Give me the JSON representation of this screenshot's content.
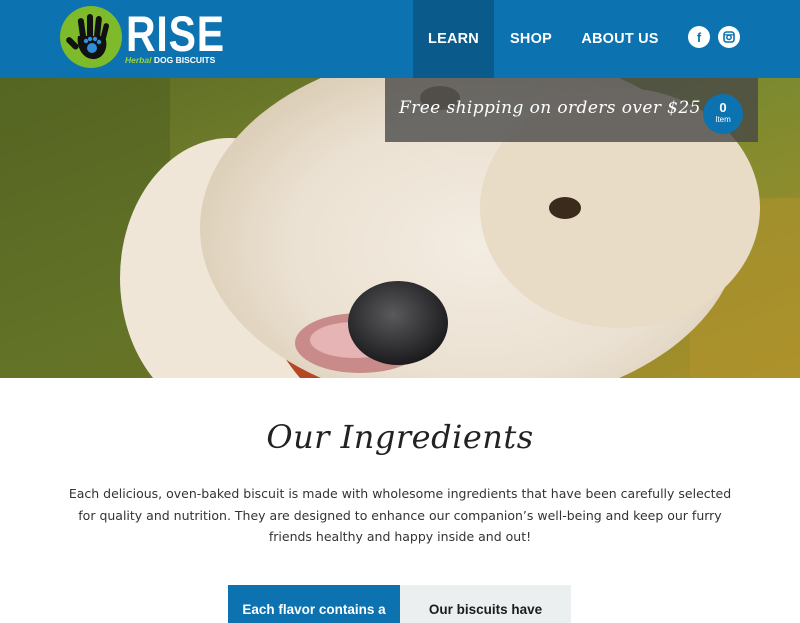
{
  "header": {
    "logo": {
      "wordmark": "RISE",
      "tagline_herbal": "Herbal",
      "tagline_rest": "DOG BISCUITS"
    },
    "nav": [
      {
        "label": "LEARN",
        "active": true
      },
      {
        "label": "SHOP",
        "active": false
      },
      {
        "label": "ABOUT US",
        "active": false
      }
    ],
    "social": {
      "facebook_glyph": "f",
      "instagram_icon": "instagram-icon"
    },
    "colors": {
      "header_bg": "#0d72b0",
      "active_nav_bg": "#0a5a8c",
      "logo_green": "#7dbb2a"
    }
  },
  "promo": {
    "text": "Free shipping on orders over $25",
    "cart_count": "0",
    "cart_label": "Item"
  },
  "hero": {
    "image": "close-up of a white fluffy dog on grass"
  },
  "main": {
    "title": "Our Ingredients",
    "body": "Each delicious, oven-baked biscuit is made with wholesome ingredients that have been carefully selected for quality and nutrition. They are designed to enhance our companion’s well-being and keep our furry friends healthy and happy inside and out!",
    "cards": [
      {
        "text": "Each flavor contains a"
      },
      {
        "text": "Our biscuits have"
      }
    ]
  }
}
